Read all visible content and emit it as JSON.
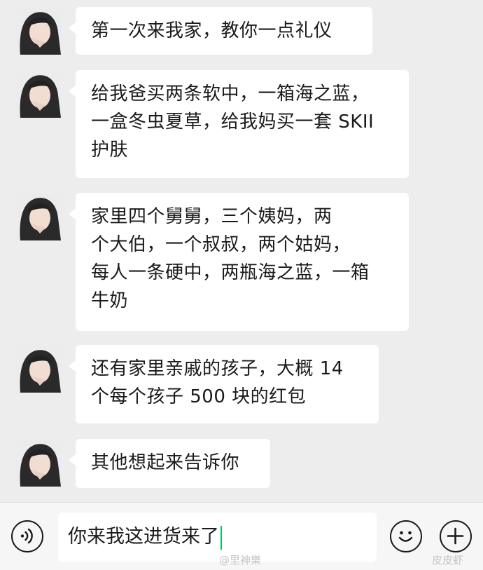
{
  "messages": [
    {
      "text": "第一次来我家，教你一点礼仪"
    },
    {
      "text": "给我爸买两条软中，一箱海之蓝，\n一盒冬虫夏草，给我妈买一套 SKII\n护肤"
    },
    {
      "text": "家里四个舅舅，三个姨妈，两\n个大伯，一个叔叔，两个姑妈，\n每人一条硬中，两瓶海之蓝，一箱\n牛奶"
    },
    {
      "text": "还有家里亲戚的孩子，大概 14\n个每个孩子 500 块的红包"
    },
    {
      "text": "其他想起来告诉你"
    }
  ],
  "input": {
    "value": "你来我这进货来了",
    "voice_icon": "voice-icon",
    "emoji_icon": "emoji-icon",
    "plus_icon": "plus-icon"
  },
  "watermarks": {
    "weibo": "@里神樂",
    "corner": "皮皮虾"
  },
  "colors": {
    "background": "#ededed",
    "bubble": "#ffffff",
    "caret": "#07c160"
  }
}
